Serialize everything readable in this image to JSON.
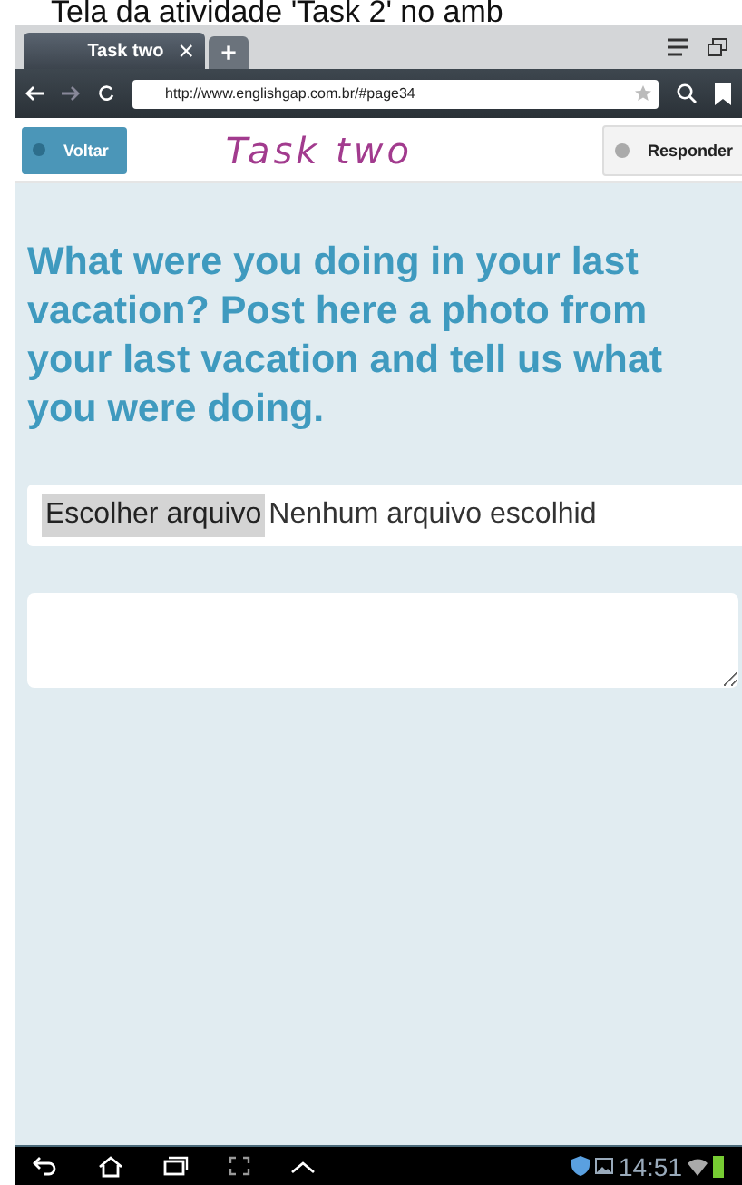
{
  "caption": "Tela da atividade 'Task 2' no amb",
  "browser": {
    "tab": {
      "title": "Task two",
      "close": "×"
    },
    "new_tab": "+",
    "url": "http://www.englishgap.com.br/#page34"
  },
  "header": {
    "back_button": "Voltar",
    "title": "Task two",
    "answer_button": "Responder"
  },
  "question": "What were you doing in your last vacation? Post here a photo from your last vacation and tell us what you were doing.",
  "file_input": {
    "button": "Escolher arquivo",
    "status": "Nenhum arquivo escolhid"
  },
  "status_bar": {
    "time": "14:51"
  }
}
